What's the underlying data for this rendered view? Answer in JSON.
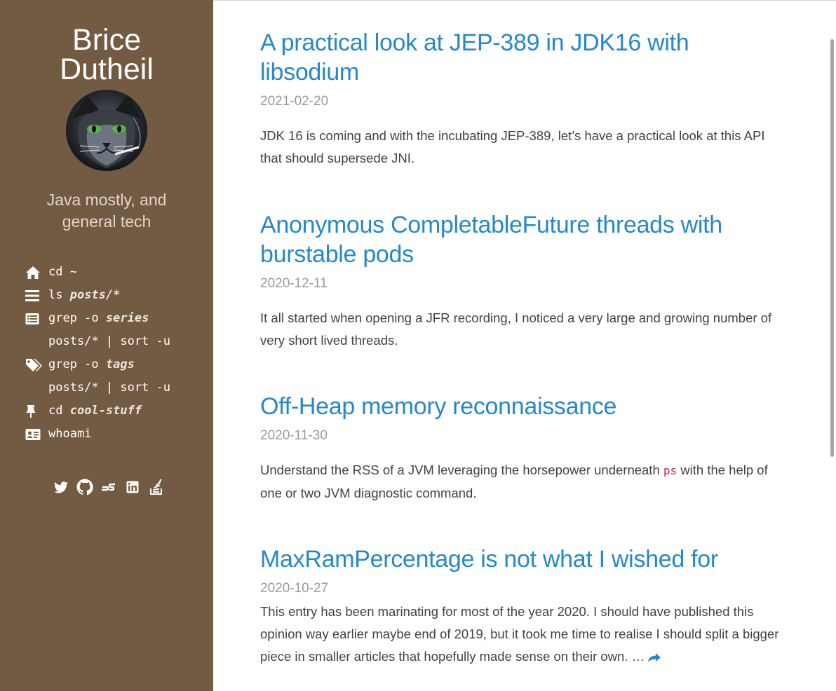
{
  "site": {
    "title_line1": "Brice",
    "title_line2": "Dutheil",
    "tagline_line1": "Java mostly, and",
    "tagline_line2": "general tech"
  },
  "nav": [
    {
      "icon": "home-icon",
      "cmd": "cd ~",
      "arg": "",
      "rest": ""
    },
    {
      "icon": "list-icon",
      "cmd": "ls ",
      "arg": "posts/*",
      "rest": ""
    },
    {
      "icon": "list-alt-icon",
      "cmd": "grep -o ",
      "arg": "series",
      "rest": "posts/* | sort -u"
    },
    {
      "icon": "tags-icon",
      "cmd": "grep -o ",
      "arg": "tags",
      "rest": "posts/* | sort -u"
    },
    {
      "icon": "thumbtack-icon",
      "cmd": "cd ",
      "arg": "cool-stuff",
      "rest": ""
    },
    {
      "icon": "id-card-icon",
      "cmd": "whoami",
      "arg": "",
      "rest": ""
    }
  ],
  "social": [
    "twitter-icon",
    "github-icon",
    "speakerdeck-icon",
    "linkedin-icon",
    "stackoverflow-icon"
  ],
  "posts": [
    {
      "title": "A practical look at JEP-389 in JDK16 with libsodium",
      "date": "2021-02-20",
      "excerpt": "JDK 16 is coming and with the incubating JEP-389, let’s have a practical look at this API that should supersede JNI."
    },
    {
      "title": "Anonymous CompletableFuture threads with burstable pods",
      "date": "2020-12-11",
      "excerpt": "It all started when opening a JFR recording, I noticed a very large and growing number of very short lived threads."
    },
    {
      "title": "Off-Heap memory reconnaissance",
      "date": "2020-11-30",
      "excerpt_before": "Understand the RSS of a JVM leveraging the horsepower underneath ",
      "excerpt_code": "ps",
      "excerpt_after": " with the help of one or two JVM diagnostic command."
    },
    {
      "title": "MaxRamPercentage is not what I wished for",
      "date": "2020-10-27",
      "excerpt": "This entry has been marinating for most of the year 2020. I should have published this opinion way earlier maybe end of 2019, but it took me time to realise I should split a bigger piece in smaller articles that hopefully made sense on their own. …"
    }
  ]
}
